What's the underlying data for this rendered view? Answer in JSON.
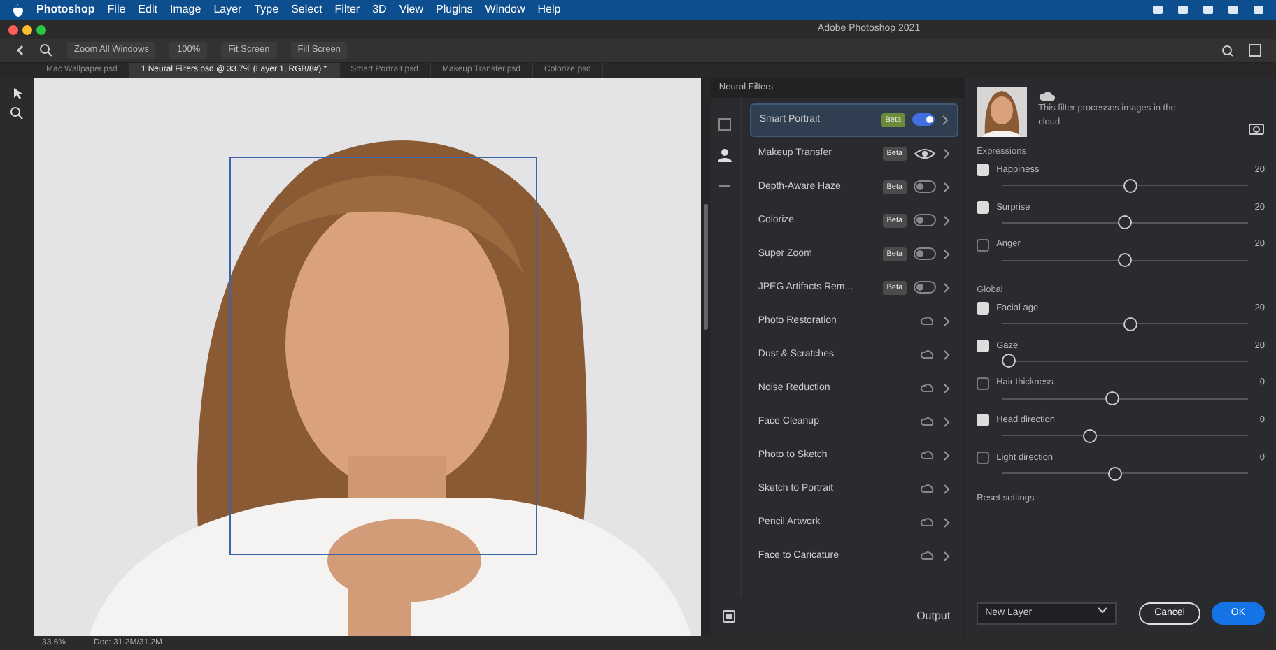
{
  "menu_bar": {
    "app": "Photoshop",
    "items": [
      "File",
      "Edit",
      "Image",
      "Layer",
      "Type",
      "Select",
      "Filter",
      "3D",
      "View",
      "Plugins",
      "Window",
      "Help"
    ]
  },
  "window": {
    "title": "Adobe Photoshop 2021"
  },
  "options_bar": {
    "buttons": [
      "Zoom All Windows",
      "100%",
      "Fit Screen",
      "Fill Screen"
    ]
  },
  "tabs": [
    {
      "label": "Mac Wallpaper.psd",
      "selected": false
    },
    {
      "label": "1 Neural Filters.psd @ 33.7% (Layer 1, RGB/8#) *",
      "selected": true
    },
    {
      "label": "Smart Portrait.psd",
      "selected": false
    },
    {
      "label": "Makeup Transfer.psd",
      "selected": false
    },
    {
      "label": "Colorize.psd",
      "selected": false
    }
  ],
  "neural_filters": {
    "title": "Neural Filters",
    "filters": [
      {
        "name": "Smart Portrait",
        "badge": "Beta",
        "kind": "toggle",
        "on": true,
        "selected": true
      },
      {
        "name": "Makeup Transfer",
        "badge": "Beta",
        "kind": "eye",
        "on": false,
        "selected": false
      },
      {
        "name": "Depth-Aware Haze",
        "badge": "Beta",
        "kind": "toggle",
        "on": false,
        "selected": false
      },
      {
        "name": "Colorize",
        "badge": "Beta",
        "kind": "toggle",
        "on": false,
        "selected": false
      },
      {
        "name": "Super Zoom",
        "badge": "Beta",
        "kind": "toggle",
        "on": false,
        "selected": false
      },
      {
        "name": "JPEG Artifacts Rem...",
        "badge": "Beta",
        "kind": "toggle",
        "on": false,
        "selected": false
      },
      {
        "name": "Photo Restoration",
        "kind": "download",
        "selected": false
      },
      {
        "name": "Dust & Scratches",
        "kind": "download",
        "selected": false
      },
      {
        "name": "Noise Reduction",
        "kind": "download",
        "selected": false
      },
      {
        "name": "Face Cleanup",
        "kind": "download",
        "selected": false
      },
      {
        "name": "Photo to Sketch",
        "kind": "download",
        "selected": false
      },
      {
        "name": "Sketch to Portrait",
        "kind": "download",
        "selected": false
      },
      {
        "name": "Pencil Artwork",
        "kind": "download",
        "selected": false
      },
      {
        "name": "Face to Caricature",
        "kind": "download",
        "selected": false
      }
    ]
  },
  "settings": {
    "cloud_note": "This filter processes images in the cloud",
    "sections": [
      {
        "title": "Expressions",
        "sliders": [
          {
            "label": "Happiness",
            "checked": true,
            "level": 0.52,
            "reading": "20"
          },
          {
            "label": "Surprise",
            "checked": true,
            "level": 0.5,
            "reading": "20"
          },
          {
            "label": "Anger",
            "checked": false,
            "level": 0.5,
            "reading": "20"
          }
        ]
      },
      {
        "title": "Global",
        "sliders": [
          {
            "label": "Facial age",
            "checked": true,
            "level": 0.52,
            "reading": "20"
          },
          {
            "label": "Gaze",
            "checked": true,
            "level": 0.03,
            "reading": "20"
          },
          {
            "label": "Hair thickness",
            "checked": false,
            "level": 0.45,
            "reading": "0"
          },
          {
            "label": "Head direction",
            "checked": true,
            "level": 0.36,
            "reading": "0"
          },
          {
            "label": "Light direction",
            "checked": false,
            "level": 0.46,
            "reading": "0"
          }
        ]
      }
    ],
    "reset": "Reset settings"
  },
  "footer": {
    "output_label": "Output",
    "output_value": "New Layer",
    "buttons": [
      "Cancel",
      "OK"
    ]
  },
  "status_bar": {
    "zoom": "33.6%",
    "doc": "Doc: 31.2M/31.2M"
  }
}
